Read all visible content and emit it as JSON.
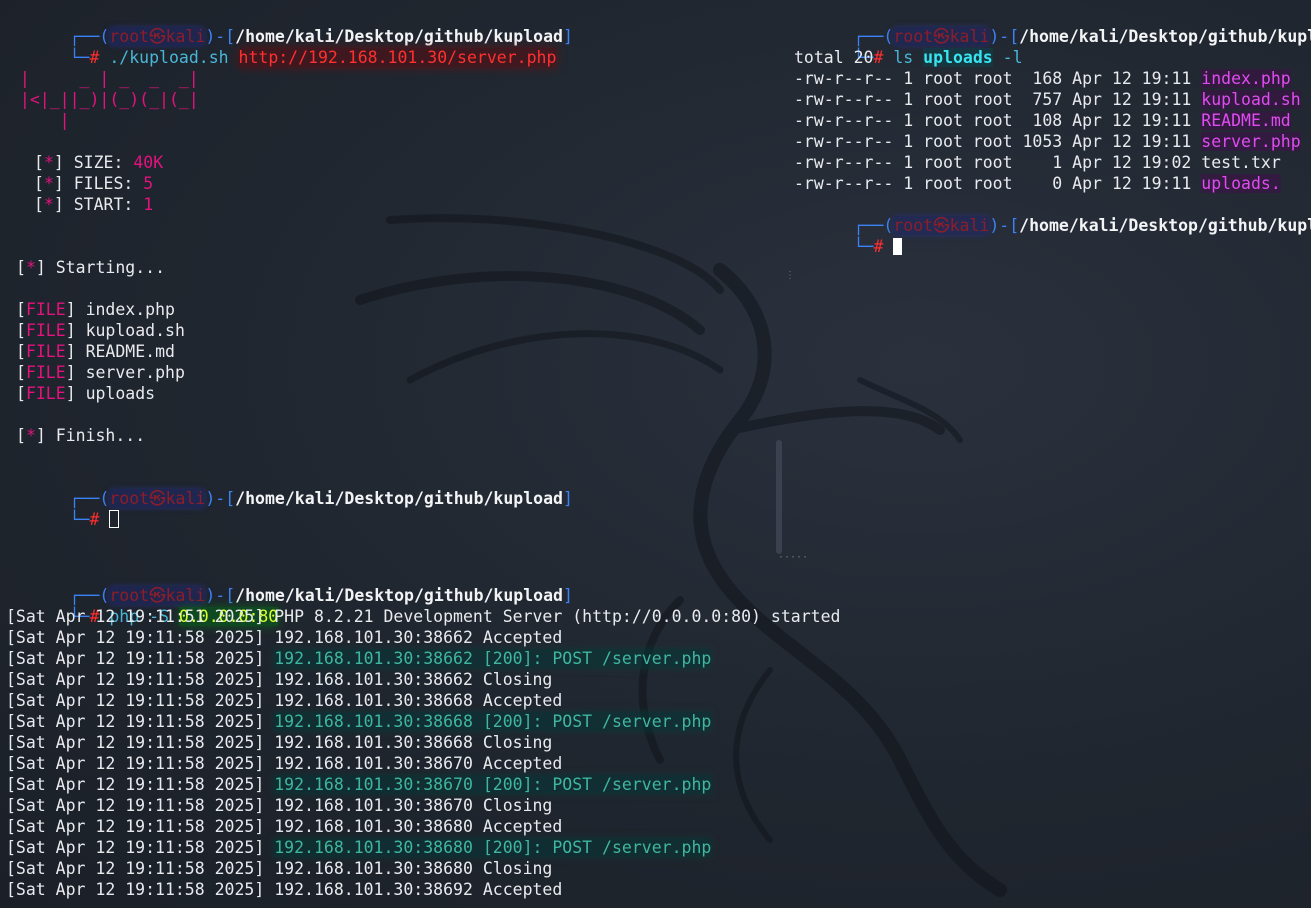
{
  "prompt": {
    "box_top": "┌──(",
    "user": "root㉿kali",
    "mid": ")-[",
    "path": "/home/kali/Desktop/github/kupload",
    "end": "]",
    "box_bottom": "└─",
    "hash": "#"
  },
  "left_pane": {
    "command": "./kupload.sh",
    "url": "http://192.168.101.30/server.php",
    "banner": [
      " |     _ | _  _  _|",
      " |<|_||_)|(_)(_|(_|",
      "     |"
    ],
    "size_label": "SIZE: ",
    "size_value": "40K",
    "files_label": "FILES: ",
    "files_value": "5",
    "start_label": "START: ",
    "start_value": "1",
    "star": "*",
    "starting": "Starting...",
    "file_tag": "FILE",
    "files": [
      "index.php",
      "kupload.sh",
      "README.md",
      "server.php",
      "uploads"
    ],
    "finish": "Finish..."
  },
  "right_pane": {
    "cmd_ls": "ls",
    "cmd_arg": "uploads",
    "cmd_flag": "-l",
    "total": "total 20",
    "listing": [
      {
        "meta": "-rw-r--r-- 1 root root  168 Apr 12 19:11 ",
        "name": "index.php",
        "hl": true
      },
      {
        "meta": "-rw-r--r-- 1 root root  757 Apr 12 19:11 ",
        "name": "kupload.sh",
        "hl": true
      },
      {
        "meta": "-rw-r--r-- 1 root root  108 Apr 12 19:11 ",
        "name": "README.md",
        "hl": true
      },
      {
        "meta": "-rw-r--r-- 1 root root 1053 Apr 12 19:11 ",
        "name": "server.php",
        "hl": true
      },
      {
        "meta": "-rw-r--r-- 1 root root    1 Apr 12 19:02 ",
        "name": "test.txr",
        "hl": false
      },
      {
        "meta": "-rw-r--r-- 1 root root    0 Apr 12 19:11 ",
        "name": "uploads.",
        "hl": true
      }
    ]
  },
  "bottom_pane": {
    "cmd": "php -S",
    "bind": "0.0.0.0:80",
    "log": [
      {
        "ts": "[Sat Apr 12 19:11:51 2025] ",
        "msg": "PHP 8.2.21 Development Server (http://0.0.0.0:80) started",
        "hl": false
      },
      {
        "ts": "[Sat Apr 12 19:11:58 2025] ",
        "msg": "192.168.101.30:38662 Accepted",
        "hl": false
      },
      {
        "ts": "[Sat Apr 12 19:11:58 2025] ",
        "msg": "192.168.101.30:38662 [200]: POST /server.php",
        "hl": true
      },
      {
        "ts": "[Sat Apr 12 19:11:58 2025] ",
        "msg": "192.168.101.30:38662 Closing",
        "hl": false
      },
      {
        "ts": "[Sat Apr 12 19:11:58 2025] ",
        "msg": "192.168.101.30:38668 Accepted",
        "hl": false
      },
      {
        "ts": "[Sat Apr 12 19:11:58 2025] ",
        "msg": "192.168.101.30:38668 [200]: POST /server.php",
        "hl": true
      },
      {
        "ts": "[Sat Apr 12 19:11:58 2025] ",
        "msg": "192.168.101.30:38668 Closing",
        "hl": false
      },
      {
        "ts": "[Sat Apr 12 19:11:58 2025] ",
        "msg": "192.168.101.30:38670 Accepted",
        "hl": false
      },
      {
        "ts": "[Sat Apr 12 19:11:58 2025] ",
        "msg": "192.168.101.30:38670 [200]: POST /server.php",
        "hl": true
      },
      {
        "ts": "[Sat Apr 12 19:11:58 2025] ",
        "msg": "192.168.101.30:38670 Closing",
        "hl": false
      },
      {
        "ts": "[Sat Apr 12 19:11:58 2025] ",
        "msg": "192.168.101.30:38680 Accepted",
        "hl": false
      },
      {
        "ts": "[Sat Apr 12 19:11:58 2025] ",
        "msg": "192.168.101.30:38680 [200]: POST /server.php",
        "hl": true
      },
      {
        "ts": "[Sat Apr 12 19:11:58 2025] ",
        "msg": "192.168.101.30:38680 Closing",
        "hl": false
      },
      {
        "ts": "[Sat Apr 12 19:11:58 2025] ",
        "msg": "192.168.101.30:38692 Accepted",
        "hl": false
      }
    ]
  },
  "theme": {
    "accent_blue": "#3b82f6",
    "prompt_red": "#ff2e2e",
    "magenta": "#e3127e",
    "teal": "#3fb6a0",
    "pink": "#e04cf0",
    "green": "#d8ff2e"
  },
  "icons": {
    "background": "kali-dragon-icon",
    "grip": "vertical-resize-grip-icon"
  }
}
